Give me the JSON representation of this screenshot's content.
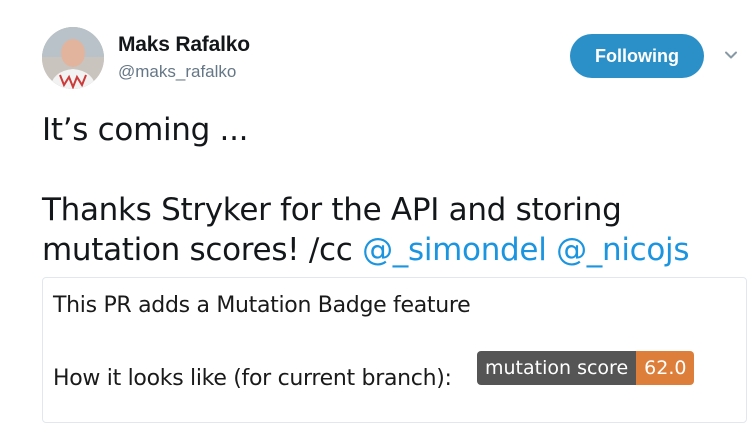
{
  "author": {
    "display_name": "Maks Rafalko",
    "username": "@maks_rafalko"
  },
  "follow_button": {
    "label": "Following"
  },
  "tweet": {
    "line1": "It’s coming ...",
    "line2_prefix": "Thanks Stryker for the API and storing",
    "line3_prefix": "mutation scores! /cc ",
    "mention1": "@_simondel",
    "mention2": "@_nicojs"
  },
  "card": {
    "line1": "This PR adds a Mutation Badge feature",
    "line2": "How it looks like (for current branch):",
    "badge_label": "mutation score",
    "badge_value": "62.0"
  },
  "colors": {
    "accent": "#1da1f2",
    "mention": "#1b95e0",
    "badge_label_bg": "#555555",
    "badge_value_bg": "#dd7f3a"
  },
  "icons": [
    "avatar",
    "chevron-down-icon"
  ]
}
